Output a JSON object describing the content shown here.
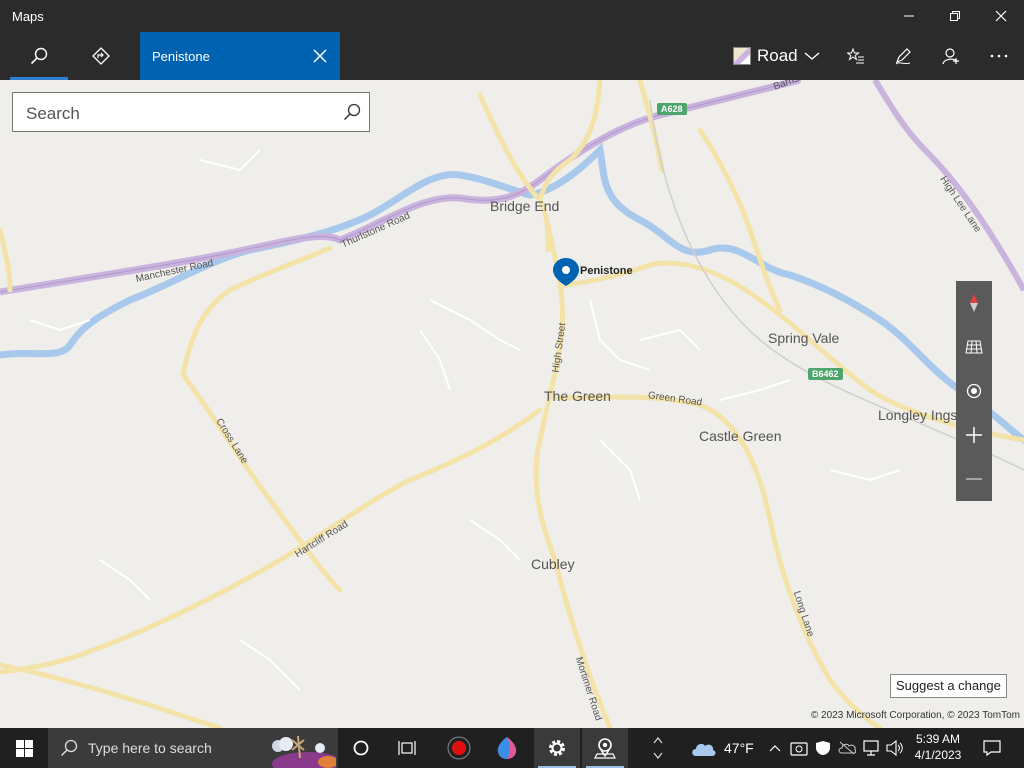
{
  "app": {
    "title": "Maps"
  },
  "window_controls": {
    "minimize": "minimize-icon",
    "maximize": "maximize-icon",
    "close": "close-icon"
  },
  "toolbar": {
    "search_icon": "search-icon",
    "directions_icon": "directions-icon",
    "tab_label": "Penistone",
    "road_label": "Road",
    "favorites_icon": "favorites-icon",
    "ink_icon": "ink-pen-icon",
    "account_icon": "account-icon",
    "more_icon": "more-icon"
  },
  "search": {
    "placeholder": "Search",
    "value": ""
  },
  "map": {
    "pin_label": "Penistone",
    "places": [
      {
        "name": "Bridge End"
      },
      {
        "name": "Spring Vale"
      },
      {
        "name": "The Green"
      },
      {
        "name": "Castle Green"
      },
      {
        "name": "Longley Ings"
      },
      {
        "name": "Cubley"
      }
    ],
    "roads": [
      {
        "name": "Manchester Road"
      },
      {
        "name": "Thurlstone Road"
      },
      {
        "name": "High Street"
      },
      {
        "name": "Green Road"
      },
      {
        "name": "Cross Lane"
      },
      {
        "name": "Hartcliff Road"
      },
      {
        "name": "Long Lane"
      },
      {
        "name": "Mortimer Road"
      },
      {
        "name": "High Lee Lane"
      },
      {
        "name": "Barnsley Road"
      }
    ],
    "shields": [
      "A628",
      "B6462"
    ],
    "controls": [
      "compass-icon",
      "tilt-icon",
      "locate-icon",
      "zoom-in-icon",
      "zoom-out-icon"
    ],
    "suggest_label": "Suggest a change",
    "copyright": "© 2023 Microsoft Corporation, © 2023 TomTom"
  },
  "taskbar": {
    "search_placeholder": "Type here to search",
    "weather": "47°F",
    "time": "5:39 AM",
    "date": "4/1/2023"
  }
}
